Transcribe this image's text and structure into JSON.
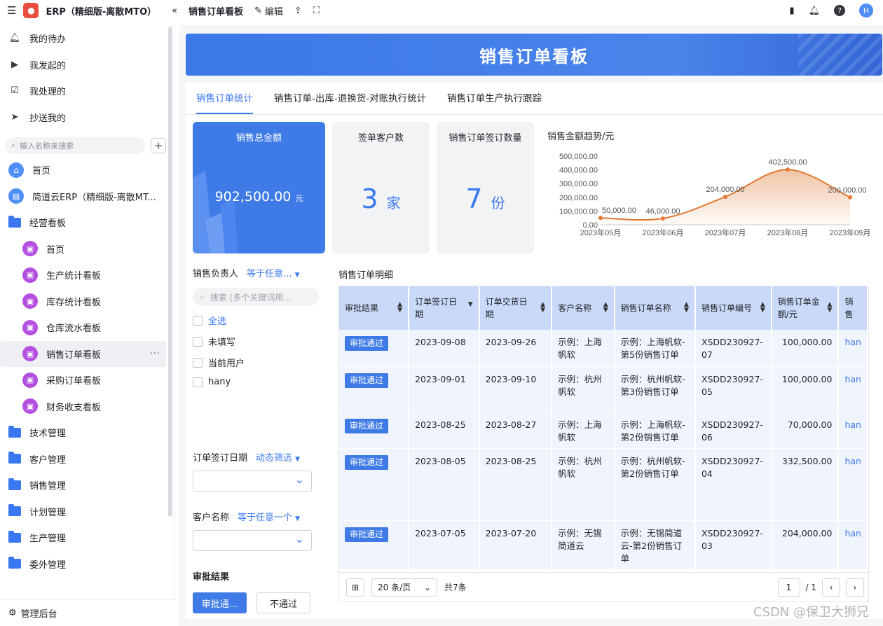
{
  "topbar": {
    "app_name": "ERP（精细版-离散MTO）",
    "page_tab": "销售订单看板",
    "edit_label": "编辑",
    "avatar_letter": "H"
  },
  "sidebar": {
    "quick": [
      {
        "label": "我的待办",
        "icon": "bell-icon"
      },
      {
        "label": "我发起的",
        "icon": "play-circle-icon"
      },
      {
        "label": "我处理的",
        "icon": "inbox-check-icon"
      },
      {
        "label": "抄送我的",
        "icon": "send-icon"
      }
    ],
    "search_placeholder": "输入名称来搜索",
    "items": [
      {
        "label": "首页",
        "type": "home"
      },
      {
        "label": "简道云ERP（精细版-离散MT...",
        "type": "doc"
      },
      {
        "label": "经营看板",
        "type": "folder-open"
      },
      {
        "label": "首页",
        "type": "board",
        "sub": true
      },
      {
        "label": "生产统计看板",
        "type": "board",
        "sub": true
      },
      {
        "label": "库存统计看板",
        "type": "board",
        "sub": true
      },
      {
        "label": "仓库流水看板",
        "type": "board",
        "sub": true
      },
      {
        "label": "销售订单看板",
        "type": "board",
        "sub": true,
        "active": true
      },
      {
        "label": "采购订单看板",
        "type": "board",
        "sub": true
      },
      {
        "label": "财务收支看板",
        "type": "board",
        "sub": true
      },
      {
        "label": "技术管理",
        "type": "folder"
      },
      {
        "label": "客户管理",
        "type": "folder"
      },
      {
        "label": "销售管理",
        "type": "folder"
      },
      {
        "label": "计划管理",
        "type": "folder"
      },
      {
        "label": "生产管理",
        "type": "folder"
      },
      {
        "label": "委外管理",
        "type": "folder"
      }
    ],
    "footer": "管理后台"
  },
  "banner": {
    "title": "销售订单看板"
  },
  "tabs": [
    "销售订单统计",
    "销售订单-出库-退换货-对账执行统计",
    "销售订单生产执行跟踪"
  ],
  "kpis": {
    "total_amount": {
      "title": "销售总金额",
      "value": "902,500.00",
      "unit": "元"
    },
    "customers": {
      "title": "签单客户数",
      "value": "3",
      "unit": "家"
    },
    "orders": {
      "title": "销售订单签订数量",
      "value": "7",
      "unit": "份"
    }
  },
  "chart_data": {
    "type": "area",
    "title": "销售金额趋势/元",
    "categories": [
      "2023年05月",
      "2023年06月",
      "2023年07月",
      "2023年08月",
      "2023年09月"
    ],
    "values": [
      50000,
      46000,
      204000,
      402500,
      200000
    ],
    "data_labels": [
      "50,000.00",
      "46,000.00",
      "204,000.00",
      "402,500.00",
      "200,000.00"
    ],
    "y_ticks": [
      "500,000.00",
      "400,000.00",
      "300,000.00",
      "200,000.00",
      "100,000.00",
      "0.00"
    ],
    "ylim": [
      0,
      500000
    ],
    "color": "#e07a36"
  },
  "filters": {
    "owner": {
      "label": "销售负责人",
      "mode": "等于任意...",
      "search_placeholder": "搜索 (多个关键词用...",
      "options": [
        "全选",
        "未填写",
        "当前用户",
        "hany"
      ]
    },
    "sign_date": {
      "label": "订单签订日期",
      "mode": "动态筛选"
    },
    "customer": {
      "label": "客户名称",
      "mode": "等于任意一个"
    },
    "approval": {
      "label": "审批结果",
      "pass": "审批通...",
      "reject": "不通过"
    }
  },
  "table": {
    "title": "销售订单明细",
    "headers": [
      "审批结果",
      "订单签订日期",
      "订单交货日期",
      "客户名称",
      "销售订单名称",
      "销售订单编号",
      "销售订单金额/元",
      "销售"
    ],
    "rows": [
      {
        "status": "审批通过",
        "sign": "2023-09-08",
        "delivery": "2023-09-26",
        "customer": "示例：上海帆软",
        "name": "示例：上海帆软-第5份销售订单",
        "code": "XSDD230927-07",
        "amount": "100,000.00",
        "owner": "han"
      },
      {
        "status": "审批通过",
        "sign": "2023-09-01",
        "delivery": "2023-09-10",
        "customer": "示例：杭州帆软",
        "name": "示例：杭州帆软-第3份销售订单",
        "code": "XSDD230927-05",
        "amount": "100,000.00",
        "owner": "han"
      },
      {
        "status": "审批通过",
        "sign": "2023-08-25",
        "delivery": "2023-08-27",
        "customer": "示例：上海帆软",
        "name": "示例：上海帆软-第2份销售订单",
        "code": "XSDD230927-06",
        "amount": "70,000.00",
        "owner": "han"
      },
      {
        "status": "审批通过",
        "sign": "2023-08-05",
        "delivery": "2023-08-25",
        "customer": "示例：杭州帆软",
        "name": "示例：杭州帆软-第2份销售订单",
        "code": "XSDD230927-04",
        "amount": "332,500.00",
        "owner": "han"
      },
      {
        "status": "审批通过",
        "sign": "2023-07-05",
        "delivery": "2023-07-20",
        "customer": "示例：无锡简道云",
        "name": "示例：无锡简道云-第2份销售订单",
        "code": "XSDD230927-03",
        "amount": "204,000.00",
        "owner": "han"
      }
    ],
    "pager": {
      "page_size": "20 条/页",
      "total": "共7条",
      "page": "1",
      "pages": "/ 1"
    }
  },
  "watermark": "CSDN @保卫大狮兄"
}
